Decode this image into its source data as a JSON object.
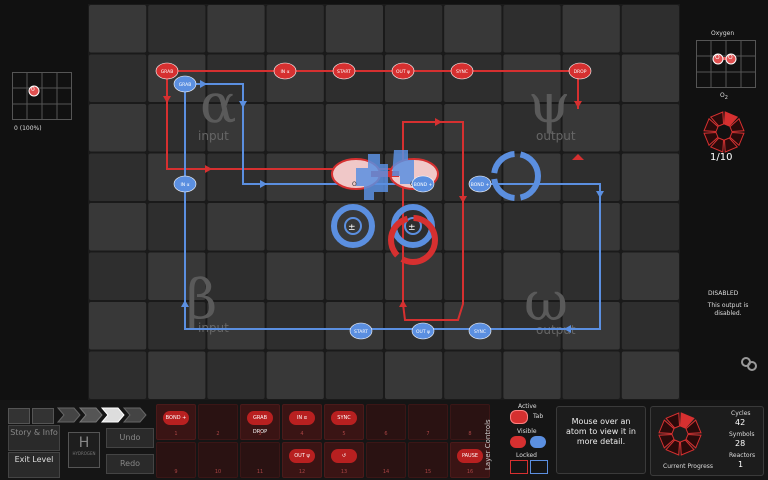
{
  "left_input": {
    "atom": "0",
    "label": "0 (100%)"
  },
  "right_output": {
    "title": "Oxygen",
    "atom_left": "O",
    "atom_right": "O",
    "formula": "O",
    "formula_sub": "2",
    "progress": "1/10",
    "progress_value": 0.1
  },
  "board": {
    "zone_alpha": {
      "glyph": "α",
      "label": "input"
    },
    "zone_psi": {
      "glyph": "ψ",
      "label": "output"
    },
    "zone_beta": {
      "glyph": "β",
      "label": "input"
    },
    "zone_omega": {
      "glyph": "ω",
      "label": "output"
    },
    "red_symbols": [
      {
        "label": "GRAB"
      },
      {
        "label": "IN α"
      },
      {
        "label": "START"
      },
      {
        "label": "OUT ψ"
      },
      {
        "label": "SYNC"
      },
      {
        "label": "DROP"
      }
    ],
    "blue_symbols": [
      {
        "label": "GRAB"
      },
      {
        "label": "IN α"
      },
      {
        "label": "BOND +"
      },
      {
        "label": "BOND +"
      },
      {
        "label": "START"
      },
      {
        "label": "OUT ψ"
      },
      {
        "label": "SYNC"
      }
    ],
    "bonder_labels": [
      "±",
      "±",
      "±"
    ],
    "molecule_labels": [
      "O",
      "O"
    ]
  },
  "disabled": {
    "title": "DISABLED",
    "text": "This output is disabled."
  },
  "toolbar": {
    "story_label": "Story & Info",
    "exit_label": "Exit Level",
    "undo_label": "Undo",
    "redo_label": "Redo",
    "hydrogen_symbol": "H",
    "hydrogen_caption": "HYDROGEN"
  },
  "instructions": {
    "top": [
      {
        "label": "BOND +",
        "num": "1"
      },
      {
        "label": "",
        "num": "2"
      },
      {
        "label": "GRAB DROP",
        "num": "3"
      },
      {
        "label": "IN α",
        "num": "4"
      },
      {
        "label": "SYNC",
        "num": "5"
      },
      {
        "label": "",
        "num": "6"
      },
      {
        "label": "",
        "num": "7"
      },
      {
        "label": "",
        "num": "8"
      }
    ],
    "bottom": [
      {
        "label": "",
        "num": "9"
      },
      {
        "label": "",
        "num": "10"
      },
      {
        "label": "",
        "num": "11"
      },
      {
        "label": "OUT ψ",
        "num": "12"
      },
      {
        "label": "↺",
        "num": "13"
      },
      {
        "label": "",
        "num": "14"
      },
      {
        "label": "",
        "num": "15"
      },
      {
        "label": "PAUSE",
        "num": "16"
      }
    ]
  },
  "layer_controls": {
    "title": "Layer Controls",
    "active": "Active",
    "tab": "Tab",
    "visible": "Visible",
    "locked": "Locked"
  },
  "hover_help": "Mouse over an atom to view it in more detail.",
  "stats": {
    "cycles_label": "Cycles",
    "cycles": "42",
    "symbols_label": "Symbols",
    "symbols": "28",
    "reactors_label": "Reactors",
    "reactors": "1",
    "progress_label": "Current Progress"
  },
  "colors": {
    "red": "#d63030",
    "blue": "#5b8fe0",
    "board": "#2e2e2e",
    "cell": "#383838"
  }
}
